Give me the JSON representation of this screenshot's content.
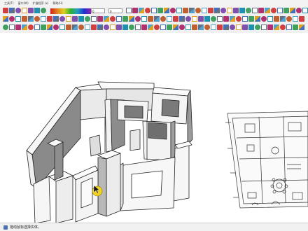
{
  "menu": {
    "items": [
      "工具(T)",
      "窗口(W)",
      "扩展程序 (x)",
      "帮助(H)"
    ]
  },
  "toolbar": {
    "field_a": "0",
    "field_b": "0"
  },
  "status": {
    "hint": "拖动鼠标选择实体。"
  },
  "colors": {
    "toolbar_bg": "#f0f0f0",
    "wall_face": "#f7f7f7",
    "wall_shade": "#7d7d7d",
    "edge": "#222222"
  },
  "icons": [
    "select-icon",
    "eraser-icon",
    "paint-bucket-icon",
    "line-icon",
    "arc-icon",
    "rectangle-icon",
    "circle-icon",
    "polygon-icon",
    "push-pull-icon",
    "move-icon",
    "rotate-icon",
    "scale-icon",
    "offset-icon",
    "tape-measure-icon",
    "text-icon",
    "axes-icon",
    "orbit-icon",
    "pan-icon",
    "zoom-icon",
    "zoom-extents-icon",
    "section-plane-icon",
    "component-icon",
    "layer-icon",
    "materials-icon",
    "styles-icon",
    "camera-icon",
    "walk-icon",
    "look-around-icon",
    "shadow-icon",
    "fog-icon"
  ]
}
